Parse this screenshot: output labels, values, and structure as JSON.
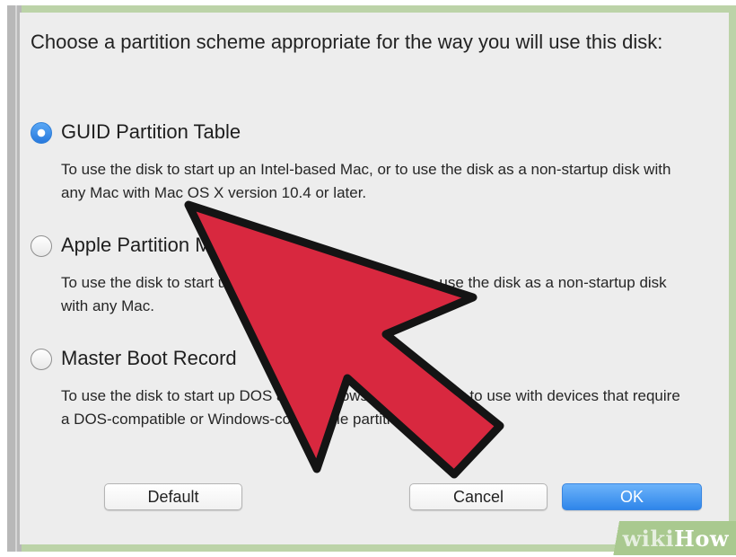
{
  "dialog": {
    "prompt": "Choose a partition scheme appropriate for the way you will use this disk:",
    "options": [
      {
        "label": "GUID Partition Table",
        "description": "To use the disk to start up an Intel-based Mac, or to use the disk as a non-startup disk with any Mac with Mac OS X version 10.4 or later.",
        "selected": true
      },
      {
        "label": "Apple Partition Map",
        "description": "To use the disk to start up a PowerPC-based Mac, or to use the disk as a non-startup disk with any Mac.",
        "selected": false
      },
      {
        "label": "Master Boot Record",
        "description": "To use the disk to start up DOS and Windows computers, or to use with devices that require a DOS-compatible or Windows-compatible partition.",
        "selected": false
      }
    ],
    "buttons": {
      "default_label": "Default",
      "cancel_label": "Cancel",
      "ok_label": "OK"
    }
  },
  "overlay": {
    "arrow_color": "#d8283f",
    "arrow_icon": "pointer-arrow-icon"
  },
  "watermark": {
    "wiki": "wiki",
    "how": "How"
  },
  "colors": {
    "accent": "#2f86ea",
    "frame": "#bcd3a8"
  }
}
